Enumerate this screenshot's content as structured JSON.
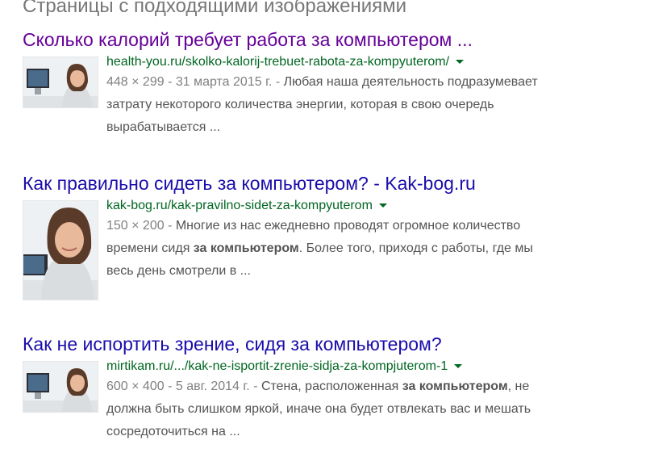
{
  "heading": "Страницы с подходящими изображениями",
  "results": [
    {
      "title": "Сколько калорий требует работа за компьютером ...",
      "url": "health-you.ru/skolko-kalorij-trebuet-rabota-za-kompyuterom/",
      "meta": "448 × 299 - 31 марта 2015 г. - ",
      "snippet_1": "Любая наша деятельность подразумевает",
      "snippet_2": "затрату некоторого количества энергии, которая в свою очередь",
      "snippet_3": "вырабатывается ..."
    },
    {
      "title": "Как правильно сидеть за компьютером? - Kak-bog.ru",
      "url": "kak-bog.ru/kak-pravilno-sidet-za-kompyuterom",
      "meta": "150 × 200 - ",
      "snippet_1": "Многие из нас ежедневно проводят огромное количество",
      "snippet_2_a": "времени сидя ",
      "snippet_2_b": "за компьютером",
      "snippet_2_c": ". Более того, приходя с работы, где мы",
      "snippet_3": "весь день смотрели в ..."
    },
    {
      "title": "Как не испортить зрение, сидя за компьютером?",
      "url": "mirtikam.ru/.../kak-ne-isportit-zrenie-sidja-za-kompjuterom-1",
      "meta": "600 × 400 - 5 авг. 2014 г. - ",
      "snippet_1_a": "Стена, расположенная ",
      "snippet_1_b": "за компьютером",
      "snippet_1_c": ", не",
      "snippet_2": "должна быть слишком яркой, иначе она будет отвлекать вас и мешать",
      "snippet_3": "сосредоточиться на ..."
    }
  ],
  "colors": {
    "visited_title": "#660099",
    "link_title": "#1a0dab",
    "url_green": "#006621",
    "snippet_gray": "#545454"
  }
}
